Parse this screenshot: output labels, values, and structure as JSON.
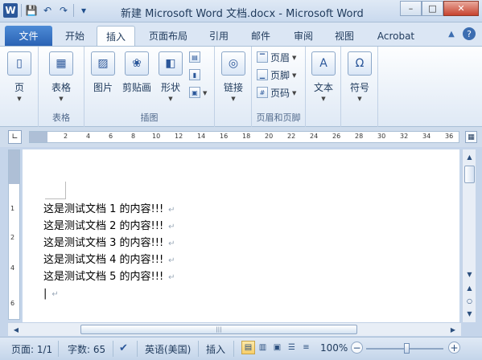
{
  "window": {
    "title": "新建 Microsoft Word 文档.docx - Microsoft Word",
    "app_icon": "W",
    "controls": {
      "minimize": "–",
      "maximize": "□",
      "close": "✕"
    }
  },
  "quick_access": {
    "save": "💾",
    "undo": "↶",
    "redo": "↷",
    "customize": "▾"
  },
  "tabs": [
    {
      "label": "文件"
    },
    {
      "label": "开始"
    },
    {
      "label": "插入"
    },
    {
      "label": "页面布局"
    },
    {
      "label": "引用"
    },
    {
      "label": "邮件"
    },
    {
      "label": "审阅"
    },
    {
      "label": "视图"
    },
    {
      "label": "Acrobat"
    }
  ],
  "ribbon": {
    "groups": {
      "pages": {
        "label": "",
        "button": "页"
      },
      "tables": {
        "label": "表格",
        "button": "表格"
      },
      "illustrations": {
        "label": "插图",
        "picture": "图片",
        "clipart": "剪贴画",
        "shapes": "形状"
      },
      "links": {
        "label": "",
        "button": "链接"
      },
      "header_footer": {
        "label": "页眉和页脚",
        "header": "页眉",
        "footer": "页脚",
        "page_number": "页码"
      },
      "text": {
        "label": "",
        "button": "文本"
      },
      "symbols": {
        "label": "",
        "button": "符号"
      }
    }
  },
  "ruler": {
    "h_ticks": [
      "2",
      "4",
      "6",
      "8",
      "10",
      "12",
      "14",
      "16",
      "18",
      "20",
      "22",
      "24",
      "26",
      "28",
      "30",
      "32",
      "34",
      "36"
    ],
    "v_ticks": [
      "1",
      "2",
      "4",
      "6"
    ]
  },
  "document": {
    "lines": [
      "这是测试文档 1 的内容!!!",
      "这是测试文档 2 的内容!!!",
      "这是测试文档 3 的内容!!!",
      "这是测试文档 4 的内容!!!",
      "这是测试文档 5 的内容!!!"
    ],
    "paragraph_mark": "↵"
  },
  "status": {
    "page": "页面: 1/1",
    "words": "字数: 65",
    "language": "英语(美国)",
    "mode": "插入",
    "zoom": "100%",
    "zoom_level": 1.0
  },
  "colors": {
    "accent": "#2b579a",
    "file_tab": "#2a62b4",
    "ribbon_bg": "#dfe9f5"
  }
}
